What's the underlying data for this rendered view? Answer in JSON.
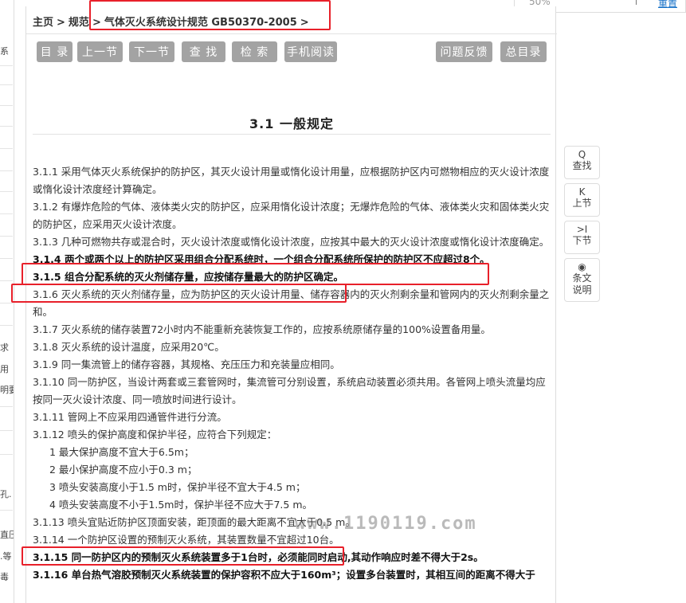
{
  "top_right": {
    "zoom_fragment": "50%",
    "link_fragment": "重置"
  },
  "left_fragments": [
    "系",
    "求",
    "用",
    "明要",
    "孔.",
    "直压",
    ".等",
    "毒"
  ],
  "breadcrumb": {
    "home": "主页",
    "category": "规范",
    "document": "气体灭火系统设计规范 GB50370-2005",
    "sep": ">"
  },
  "toolbar": {
    "toc": "目 录",
    "prev_section": "上一节",
    "next_section": "下一节",
    "find": "查 找",
    "search": "检 索",
    "mobile_read": "手机阅读",
    "feedback": "问题反馈",
    "main_toc": "总目录"
  },
  "section": {
    "title": "3.1  一般规定",
    "clauses": [
      "3.1.1 采用气体灭火系统保护的防护区，其灭火设计用量或惰化设计用量，应根据防护区内可燃物相应的灭火设计浓度或惰化设计浓度经计算确定。",
      "3.1.2 有爆炸危险的气体、液体类火灾的防护区，应采用惰化设计浓度；无爆炸危险的气体、液体类火灾和固体类火灾的防护区，应采用灭火设计浓度。",
      "3.1.3 几种可燃物共存或混合时，灭火设计浓度或惰化设计浓度，应按其中最大的灭火设计浓度或惰化设计浓度确定。",
      "3.1.4 两个或两个以上的防护区采用组合分配系统时，一个组合分配系统所保护的防护区不应超过8个。",
      "3.1.5 组合分配系统的灭火剂储存量，应按储存量最大的防护区确定。",
      "3.1.6 灭火系统的灭火剂储存量，应为防护区的灭火设计用量、储存容器内的灭火剂剩余量和管网内的灭火剂剩余量之和。",
      "3.1.7 灭火系统的储存装置72小时内不能重新充装恢复工作的，应按系统原储存量的100%设置备用量。",
      "3.1.8 灭火系统的设计温度，应采用20℃。",
      "3.1.9 同一集流管上的储存容器，其规格、充压压力和充装量应相同。",
      "3.1.10 同一防护区，当设计两套或三套管网时，集流管可分别设置，系统启动装置必须共用。各管网上喷头流量均应按同一灭火设计浓度、同一喷放时间进行设计。",
      "3.1.11 管网上不应采用四通管件进行分流。",
      "3.1.12 喷头的保护高度和保护半径，应符合下列规定：",
      "1 最大保护高度不宜大于6.5m；",
      "2 最小保护高度不应小于0.3 m；",
      "3 喷头安装高度小于1.5 m时，保护半径不宜大于4.5 m；",
      "4 喷头安装高度不小于1.5m时，保护半径不应大于7.5 m。",
      "3.1.13 喷头宜贴近防护区顶面安装，距顶面的最大距离不宜大于0.5 m。",
      "3.1.14 一个防护区设置的预制灭火系统，其装置数量不宜超过10台。",
      "3.1.15 同一防护区内的预制灭火系统装置多于1台时，必须能同时启动,其动作响应时差不得大于2s。",
      "3.1.16 单台热气溶胶预制灭火系统装置的保护容积不应大于160m³；设置多台装置时，其相互间的距离不得大于"
    ]
  },
  "watermark": "www.1190119.com",
  "side_tools": {
    "find_icon_glyph": "Q",
    "find": "查找",
    "prev_icon_glyph": "K",
    "prev": "上节",
    "next_icon_glyph": ">I",
    "next": "下节",
    "explain_icon_glyph": "◉",
    "explain": "条文说明"
  },
  "colors": {
    "button_bg": "#a3a3a3",
    "highlight_red": "#e8202a",
    "link_blue": "#1a73c8"
  }
}
